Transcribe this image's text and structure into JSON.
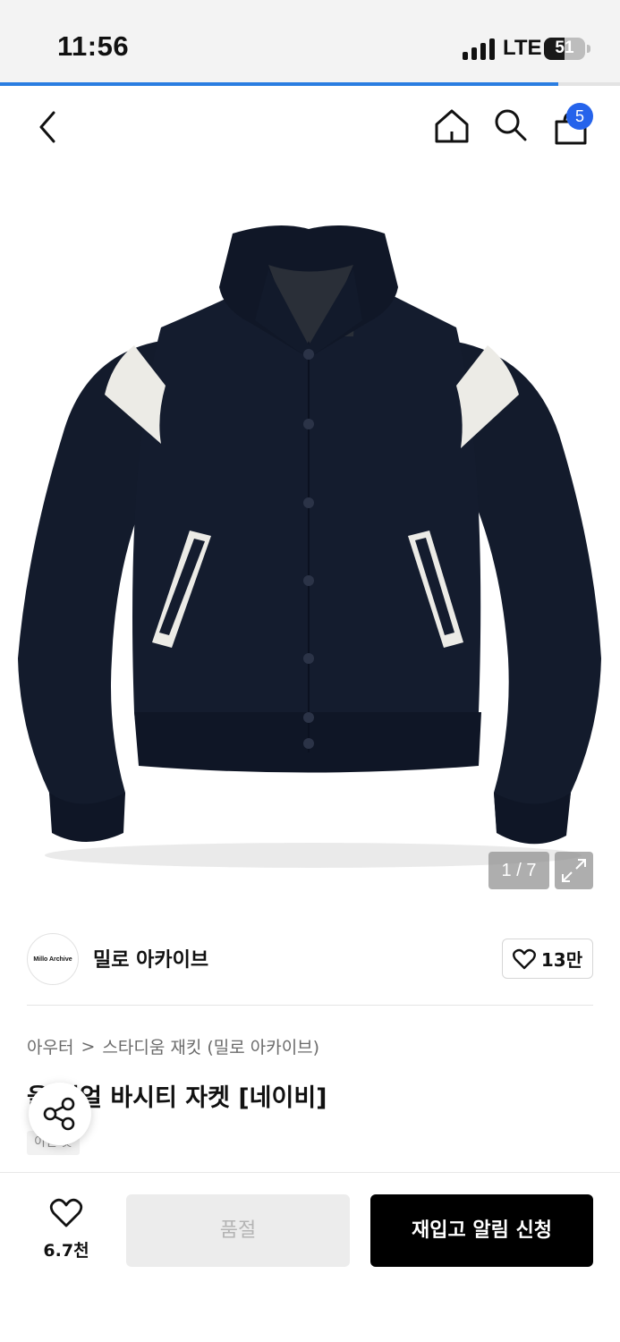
{
  "status_bar": {
    "time": "11:56",
    "network": "LTE",
    "battery": "51",
    "battery_level": 0.51
  },
  "page_load_progress": 0.9,
  "header": {
    "cart_count": "5",
    "icons": [
      "back-arrow-icon",
      "home-icon",
      "search-icon",
      "shopping-bag-icon"
    ]
  },
  "gallery": {
    "counter": "1 / 7",
    "current_index": 1,
    "total": 7
  },
  "brand": {
    "logo_text": "Millo Archive",
    "name": "밀로 아카이브",
    "likes": "13만"
  },
  "breadcrumb": {
    "category": "아우터",
    "separator": ">",
    "subcategory": "스타디움 재킷 (밀로 아카이브)"
  },
  "product": {
    "title": "울 셔얼 바시티 자켓 [네이비]",
    "tag": "이번 옷"
  },
  "actions": {
    "wishlist_count": "6.7천",
    "soldout_label": "품절",
    "restock_label": "재입고 알림 신청"
  },
  "colors": {
    "accent": "#2563eb",
    "jacket_navy": "#141c2e",
    "primary_button": "#000000"
  }
}
